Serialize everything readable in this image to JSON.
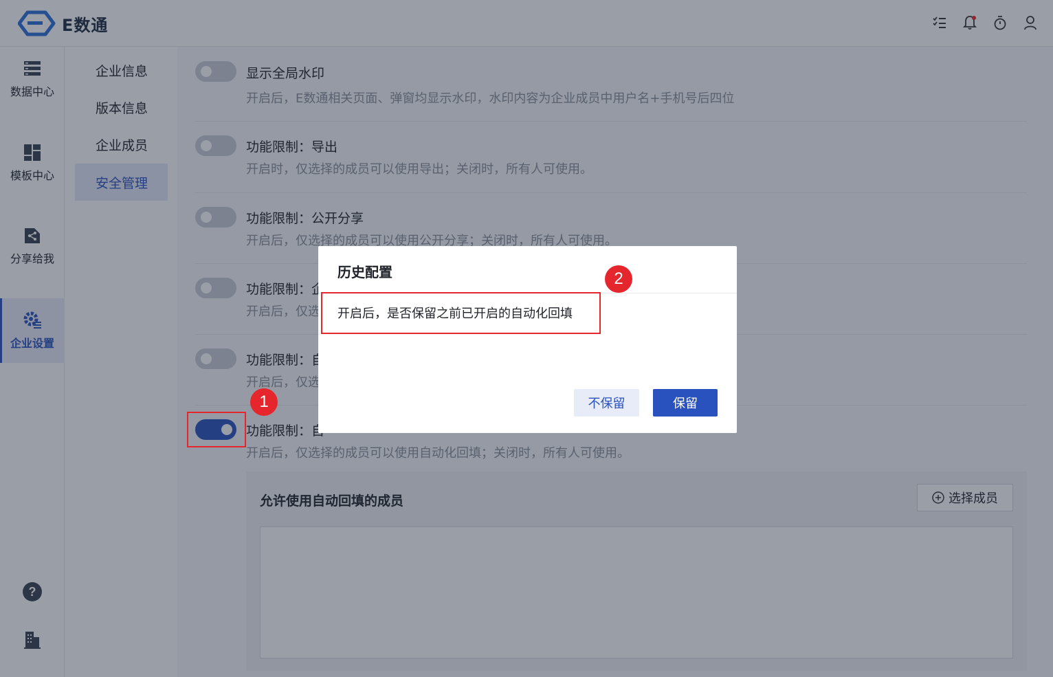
{
  "app": {
    "name": "E数通",
    "brand_color": "#2a52be"
  },
  "header": {
    "icons": [
      "task-list-icon",
      "bell-icon",
      "timer-icon",
      "user-icon"
    ]
  },
  "rail": {
    "items": [
      {
        "label": "数据中心",
        "icon": "server-icon"
      },
      {
        "label": "模板中心",
        "icon": "template-icon"
      },
      {
        "label": "分享给我",
        "icon": "share-icon"
      },
      {
        "label": "企业设置",
        "icon": "gear-icon",
        "active": true
      }
    ],
    "bottom_icons": [
      "help-icon",
      "building-icon"
    ]
  },
  "subnav": {
    "items": [
      {
        "label": "企业信息"
      },
      {
        "label": "版本信息"
      },
      {
        "label": "企业成员"
      },
      {
        "label": "安全管理",
        "active": true
      }
    ]
  },
  "settings": [
    {
      "title": "显示全局水印",
      "desc": "开启后，E数通相关页面、弹窗均显示水印，水印内容为企业成员中用户名+手机号后四位",
      "on": false
    },
    {
      "title": "功能限制：导出",
      "desc": "开启时，仅选择的成员可以使用导出；关闭时，所有人可使用。",
      "on": false
    },
    {
      "title": "功能限制：公开分享",
      "desc": "开启后，仅选择的成员可以使用公开分享；关闭时，所有人可使用。",
      "on": false
    },
    {
      "title": "功能限制：企",
      "desc": "开启后，仅选",
      "on": false
    },
    {
      "title": "功能限制：自",
      "desc": "开启后，仅选",
      "on": false
    },
    {
      "title": "功能限制：自",
      "desc": "开启后，仅选择的成员可以使用自动化回填；关闭时，所有人可使用。",
      "on": true
    }
  ],
  "member_section": {
    "title": "允许使用自动回填的成员",
    "select_button": "选择成员"
  },
  "modal": {
    "title": "历史配置",
    "body": "开启后，是否保留之前已开启的自动化回填",
    "cancel_label": "不保留",
    "confirm_label": "保留"
  },
  "annotations": {
    "badge_1": "1",
    "badge_2": "2",
    "color": "#e5262d"
  }
}
